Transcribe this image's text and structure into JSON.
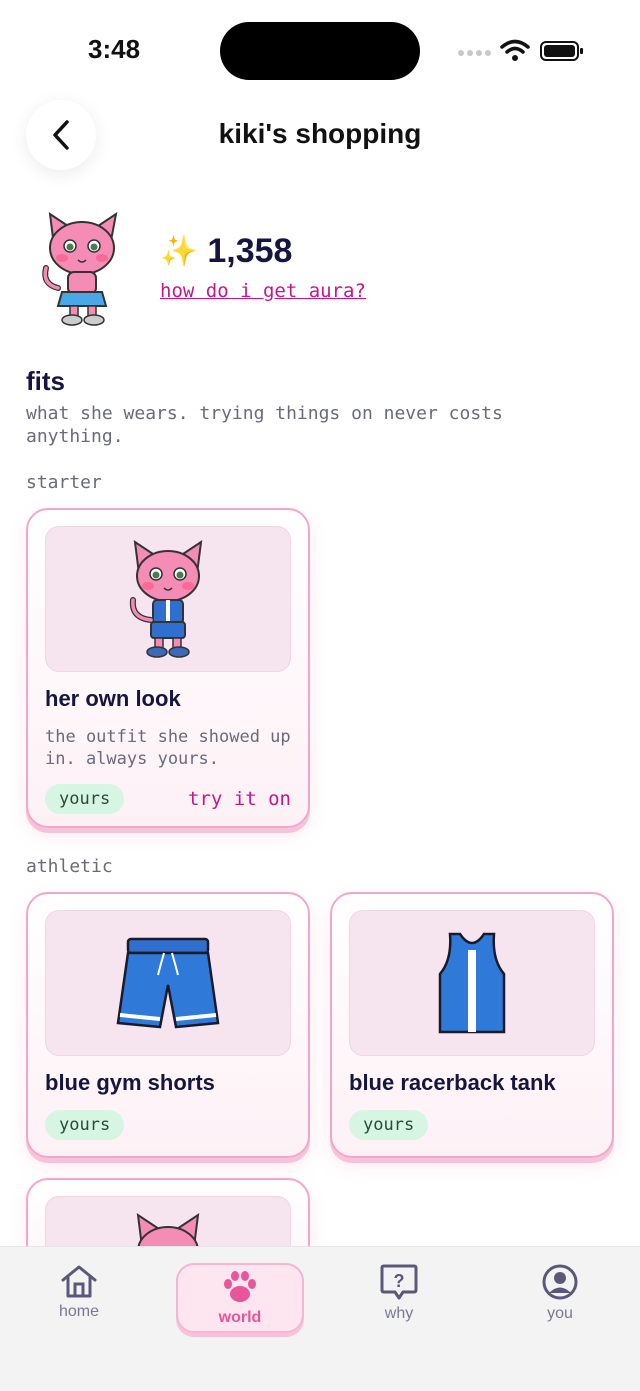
{
  "status": {
    "time": "3:48"
  },
  "header": {
    "title": "kiki's shopping"
  },
  "profile": {
    "sparkle": "✨",
    "aura": "1,358",
    "aura_link": "how do i get aura?"
  },
  "section": {
    "title": "fits",
    "subtitle": "what she wears. trying things on never costs anything."
  },
  "groups": [
    {
      "label": "starter",
      "items": [
        {
          "title": "her own look",
          "desc": "the outfit she showed up in. always yours.",
          "badge": "yours",
          "action": "try it on"
        }
      ]
    },
    {
      "label": "athletic",
      "items": [
        {
          "title": "blue gym shorts",
          "badge": "yours"
        },
        {
          "title": "blue racerback tank",
          "badge": "yours"
        }
      ]
    }
  ],
  "tabs": [
    {
      "label": "home",
      "icon": "home-icon"
    },
    {
      "label": "world",
      "icon": "paw-icon",
      "active": true
    },
    {
      "label": "why",
      "icon": "question-icon"
    },
    {
      "label": "you",
      "icon": "user-icon"
    }
  ],
  "colors": {
    "accent": "#e8559a",
    "link": "#c2188a",
    "card_border": "#f3a6cb",
    "badge_bg": "#d7f5e3"
  }
}
